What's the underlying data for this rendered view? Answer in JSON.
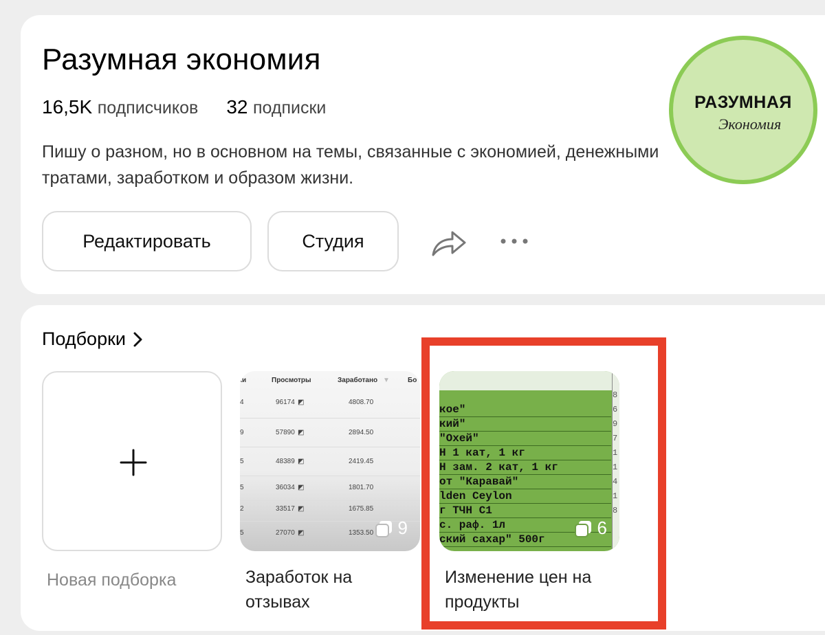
{
  "profile": {
    "title": "Разумная экономия",
    "subscribers_count": "16,5K",
    "subscribers_label": "подписчиков",
    "subscriptions_count": "32",
    "subscriptions_label": "подписки",
    "description": "Пишу о разном, но в основном на темы, связанные с экономией, денежными тратами, заработком и образом жизни.",
    "edit_label": "Редактировать",
    "studio_label": "Студия",
    "avatar": {
      "logo_main": "РАЗУМНАЯ",
      "logo_sub": "Экономия",
      "fill_color": "#cfe8b0",
      "ring_color": "#8ccb55"
    }
  },
  "collections": {
    "title": "Подборки",
    "new_label": "Новая подборка",
    "items": [
      {
        "caption": "Заработок на отзывах",
        "count": "9",
        "thumb_table": {
          "headers": [
            "Просмотры",
            "Заработано",
            "Бо"
          ],
          "rows": [
            {
              "views": "96174",
              "earned": "4808.70"
            },
            {
              "views": "57890",
              "earned": "2894.50"
            },
            {
              "views": "48389",
              "earned": "2419.45"
            },
            {
              "views": "36034",
              "earned": "1801.70"
            },
            {
              "views": "33517",
              "earned": "1675.85"
            },
            {
              "views": "27070",
              "earned": "1353.50"
            }
          ]
        }
      },
      {
        "caption": "Изменение цен на продукты",
        "count": "6",
        "thumb_lines": [
          "кое\"",
          "кий\"",
          "\"Охей\"",
          "Н 1 кат, 1 кг",
          "Н зам. 2 кат, 1 кг",
          "от \"Каравай\"",
          "lden Ceylon",
          "г ТЧН С1",
          "с. раф. 1л",
          "ский сахар\" 500г"
        ],
        "thumb_side": [
          "8",
          "6",
          "9",
          "7",
          "1",
          "1",
          "4",
          "1",
          "8",
          ""
        ]
      }
    ]
  },
  "colors": {
    "page_bg": "#eeeeee",
    "card_bg": "#ffffff",
    "highlight": "#e8402a",
    "thumb_green": "#78b04a"
  }
}
